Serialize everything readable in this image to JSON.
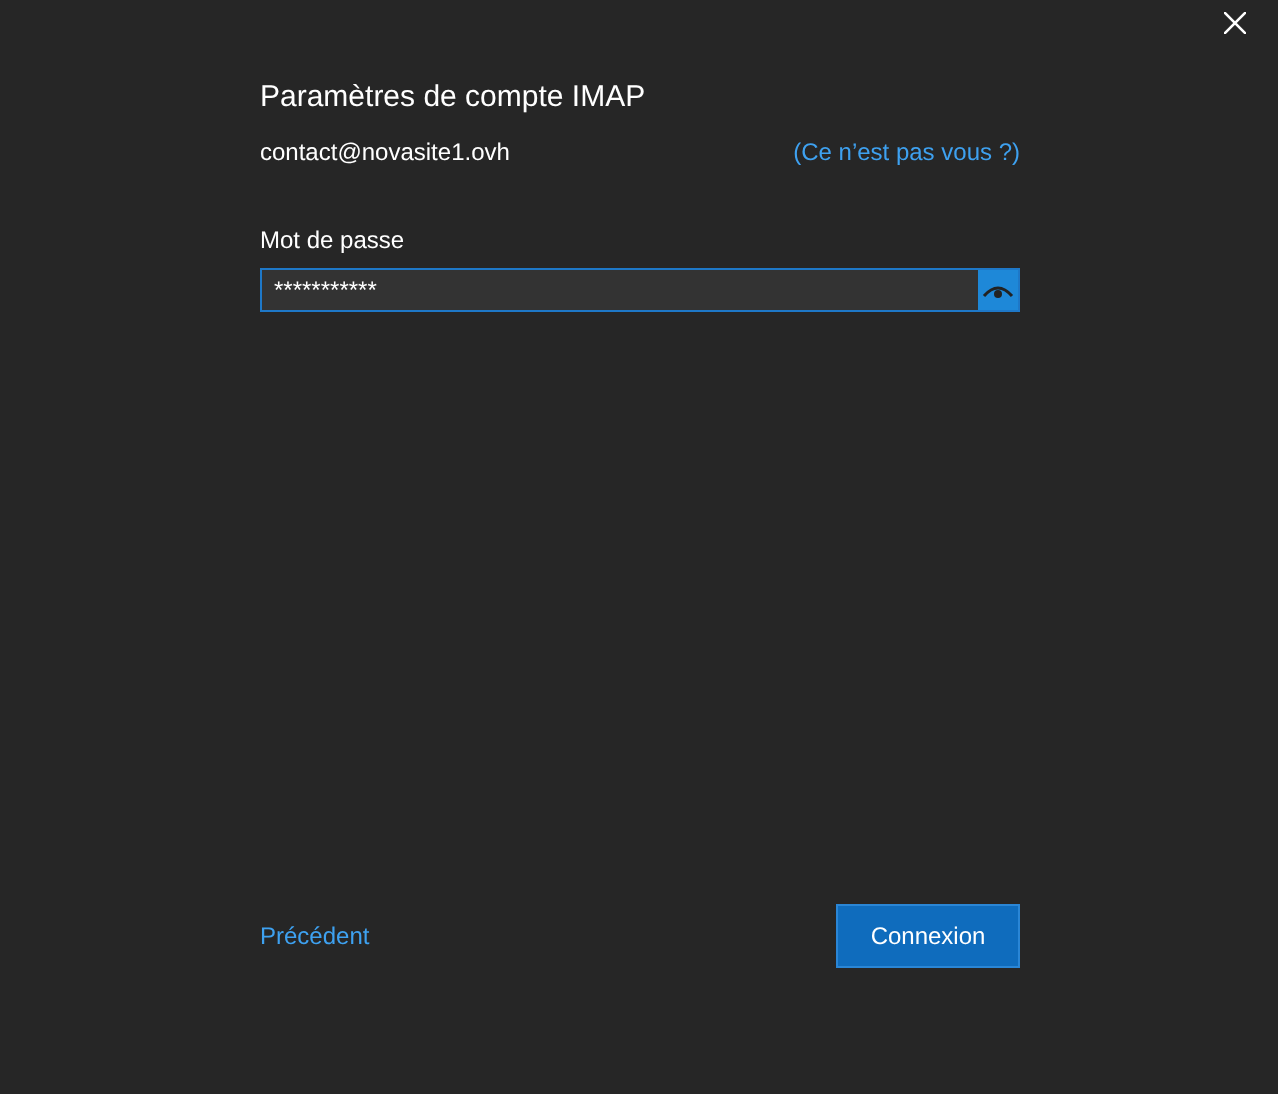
{
  "title": "Paramètres de compte IMAP",
  "account": "contact@novasite1.ovh",
  "not_you_link": "(Ce n’est pas vous ?)",
  "password": {
    "label": "Mot de passe",
    "value": "***********"
  },
  "back_link": "Précédent",
  "connect_button": "Connexion"
}
